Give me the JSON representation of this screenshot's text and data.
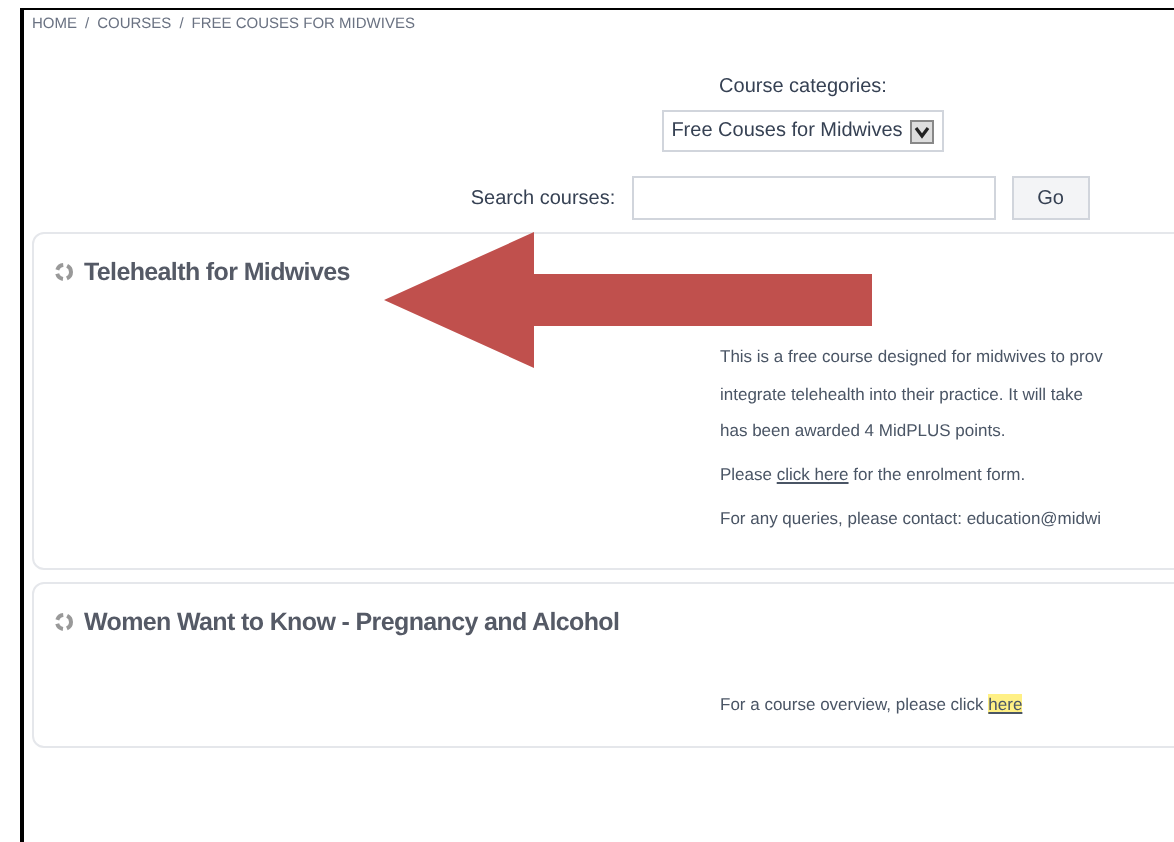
{
  "breadcrumb": {
    "separator": "/",
    "items": [
      "HOME",
      "COURSES",
      "FREE COUSES FOR MIDWIVES"
    ]
  },
  "categories": {
    "label": "Course categories:",
    "value": "Free Couses for Midwives"
  },
  "search": {
    "label": "Search courses:",
    "button": "Go"
  },
  "courses": [
    {
      "title": "Telehealth for Midwives",
      "paragraphs": [
        {
          "kind": "lines",
          "lines": [
            "This is a free course designed for midwives to prov",
            "integrate telehealth into their practice. It will take",
            "has been awarded 4 MidPLUS points."
          ]
        },
        {
          "kind": "link",
          "before": "Please ",
          "link": "click here",
          "after": " for the enrolment form.",
          "highlight": false
        },
        {
          "kind": "lines",
          "lines": [
            "For any queries, please contact: education@midwi"
          ]
        }
      ]
    },
    {
      "title": "Women Want to Know - Pregnancy and Alcohol",
      "paragraphs": [
        {
          "kind": "link",
          "before": "For a course overview, please click ",
          "link": "here",
          "highlight": true
        }
      ]
    }
  ]
}
